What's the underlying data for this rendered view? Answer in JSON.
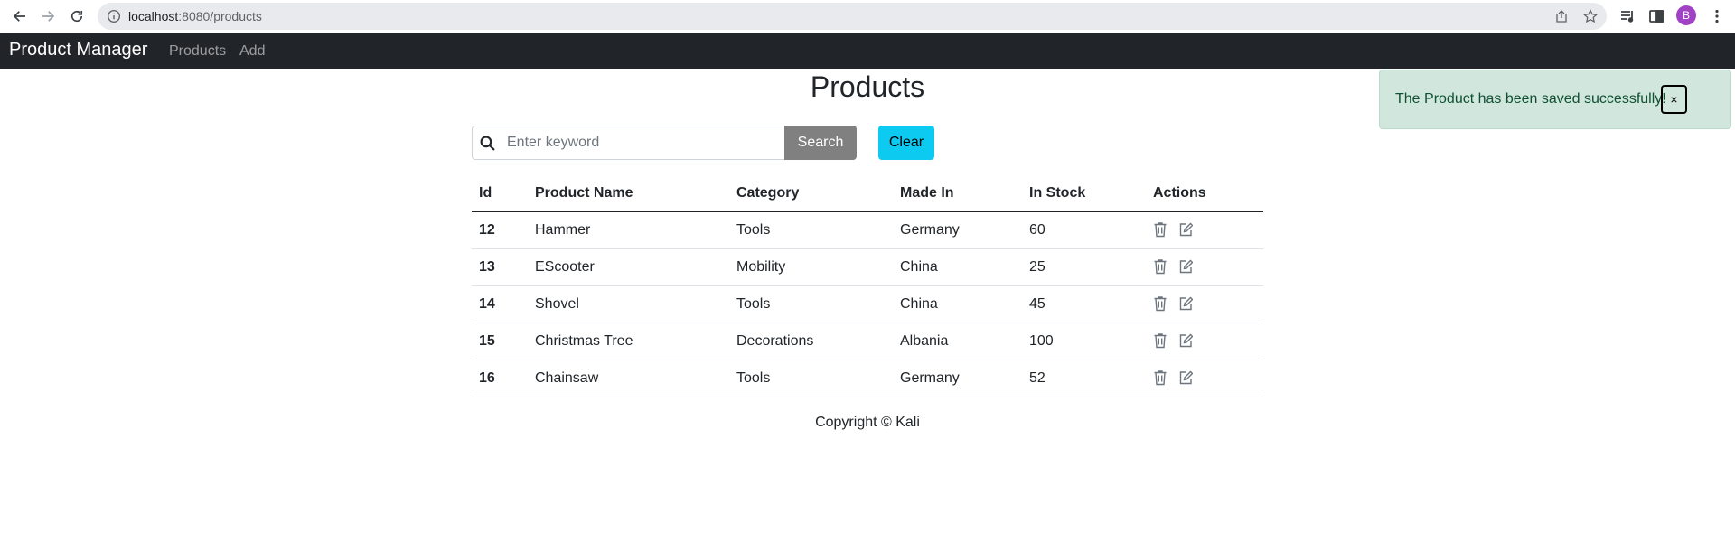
{
  "browser": {
    "url_host": "localhost",
    "url_rest": ":8080/products",
    "profile_initial": "B"
  },
  "navbar": {
    "brand": "Product Manager",
    "links": [
      "Products",
      "Add"
    ]
  },
  "page": {
    "title": "Products"
  },
  "search": {
    "placeholder": "Enter keyword",
    "value": "",
    "search_label": "Search",
    "clear_label": "Clear"
  },
  "table": {
    "headers": [
      "Id",
      "Product Name",
      "Category",
      "Made In",
      "In Stock",
      "Actions"
    ],
    "rows": [
      {
        "id": "12",
        "name": "Hammer",
        "category": "Tools",
        "made_in": "Germany",
        "in_stock": "60"
      },
      {
        "id": "13",
        "name": "EScooter",
        "category": "Mobility",
        "made_in": "China",
        "in_stock": "25"
      },
      {
        "id": "14",
        "name": "Shovel",
        "category": "Tools",
        "made_in": "China",
        "in_stock": "45"
      },
      {
        "id": "15",
        "name": "Christmas Tree",
        "category": "Decorations",
        "made_in": "Albania",
        "in_stock": "100"
      },
      {
        "id": "16",
        "name": "Chainsaw",
        "category": "Tools",
        "made_in": "Germany",
        "in_stock": "52"
      }
    ]
  },
  "footer": {
    "text": "Copyright © Kali"
  },
  "alert": {
    "message": "The Product has been saved successfully!",
    "close_label": "×"
  },
  "colors": {
    "navbar_bg": "#212529",
    "search_button": "#808080",
    "clear_button": "#0dcaf0",
    "alert_bg": "#d1e7dd",
    "alert_text": "#0f5132",
    "avatar": "#a142c4"
  }
}
